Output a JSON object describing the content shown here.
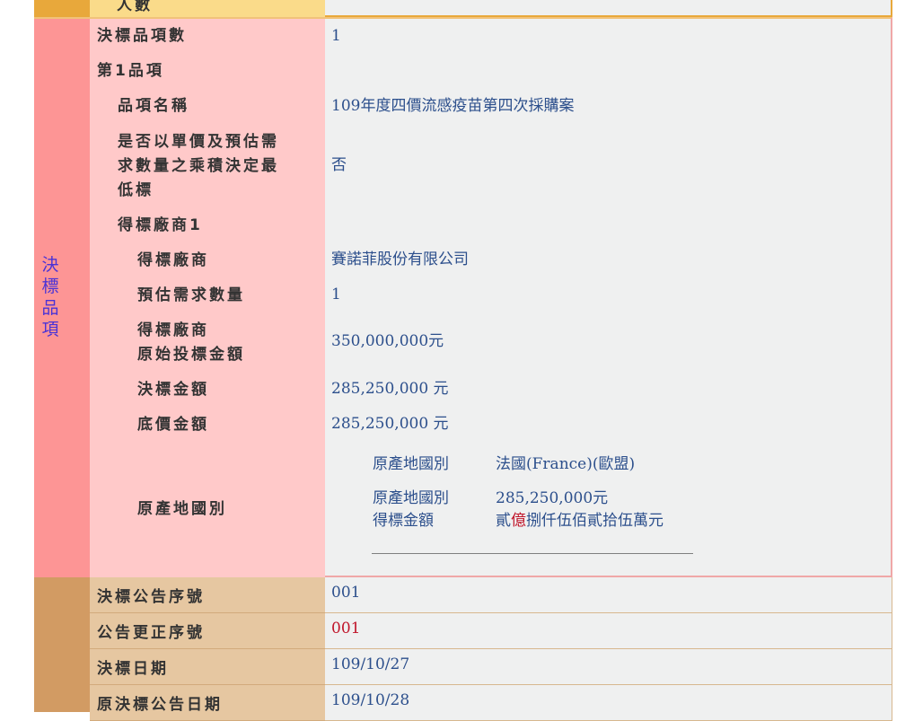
{
  "top": {
    "label": "人數"
  },
  "award": {
    "side_chars": [
      "決",
      "標",
      "品",
      "項"
    ],
    "item_count_label": "決標品項數",
    "item_count_value": "1",
    "item_header_prefix": "第",
    "item_header_num": "1",
    "item_header_suffix": "品項",
    "item_name_label": "品項名稱",
    "item_name_value": "109年度四價流感疫苗第四次採購案",
    "unit_price_label_1": "是否以單價及預估需",
    "unit_price_label_2": "求數量之乘積決定最",
    "unit_price_label_3": "低標",
    "unit_price_value": "否",
    "vendor_header_prefix": "得標廠商",
    "vendor_header_num": "1",
    "vendor_label": "得標廠商",
    "vendor_value": "賽諾菲股份有限公司",
    "qty_label": "預估需求數量",
    "qty_value": "1",
    "orig_bid_label_1": "得標廠商",
    "orig_bid_label_2": "原始投標金額",
    "orig_bid_value": "350,000,000元",
    "award_amount_label": "決標金額",
    "award_amount_value": "285,250,000 元",
    "floor_price_label": "底價金額",
    "floor_price_value": "285,250,000 元",
    "origin_label": "原產地國別",
    "origin_sub": {
      "country_label": "原產地國別",
      "country_value": "法國(France)(歐盟)",
      "amount_label_1": "原產地國別",
      "amount_label_2": "得標金額",
      "amount_value": "285,250,000元",
      "amount_words_pre": "貳",
      "amount_words_red": "億",
      "amount_words_post": "捌仟伍佰貳拾伍萬元"
    }
  },
  "bottom": {
    "rows": [
      {
        "label": "決標公告序號",
        "value": "001"
      },
      {
        "label": "公告更正序號",
        "value": "001"
      },
      {
        "label": "決標日期",
        "value": "109/10/27"
      },
      {
        "label": "原決標公告日期",
        "value": "109/10/28"
      }
    ]
  }
}
